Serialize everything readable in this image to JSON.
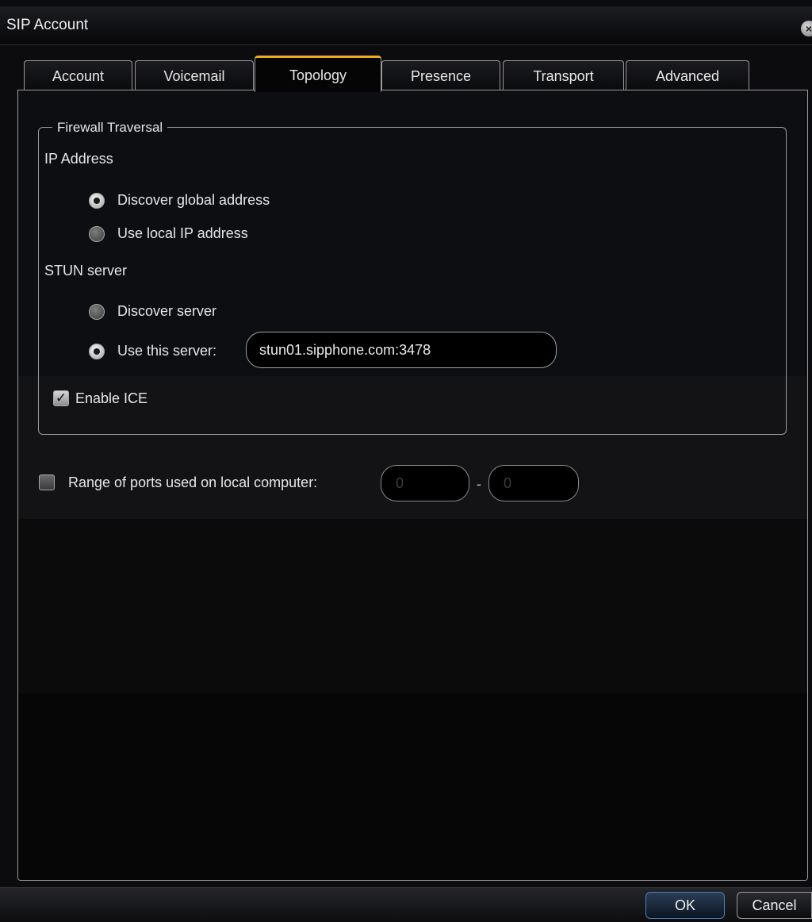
{
  "window": {
    "title": "SIP Account"
  },
  "tabs": [
    {
      "label": "Account"
    },
    {
      "label": "Voicemail"
    },
    {
      "label": "Topology"
    },
    {
      "label": "Presence"
    },
    {
      "label": "Transport"
    },
    {
      "label": "Advanced"
    }
  ],
  "active_tab": "Topology",
  "firewall": {
    "legend": "Firewall Traversal",
    "ip_address_label": "IP Address",
    "ip_options": [
      {
        "label": "Discover global address",
        "selected": true
      },
      {
        "label": "Use local IP address",
        "selected": false
      }
    ],
    "stun_label": "STUN server",
    "stun_options": [
      {
        "label": "Discover server",
        "selected": false
      },
      {
        "label": "Use this server:",
        "selected": true
      }
    ],
    "stun_server_value": "stun01.sipphone.com:3478",
    "enable_ice": {
      "label": "Enable ICE",
      "checked": true
    }
  },
  "ports": {
    "label": "Range of ports used on local computer:",
    "checked": false,
    "from": "0",
    "separator": "-",
    "to": "0"
  },
  "buttons": {
    "ok": "OK",
    "cancel": "Cancel"
  },
  "colors": {
    "accent": "#f0a81e",
    "background": "#0c0c0e",
    "primary_button_border": "#4a7fb8"
  }
}
